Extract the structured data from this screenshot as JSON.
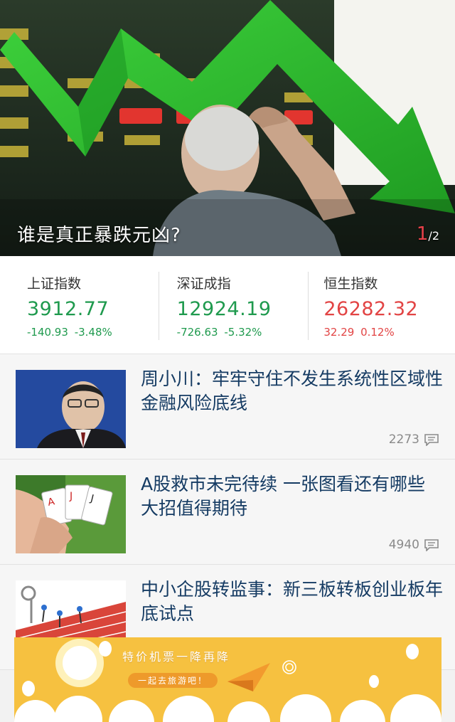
{
  "hero": {
    "caption": "谁是真正暴跌元凶?",
    "page_current": "1",
    "page_total": "2",
    "page_separator": "/"
  },
  "indices": [
    {
      "name": "上证指数",
      "value": "3912.77",
      "change": "-140.93",
      "percent": "-3.48%",
      "trend": "down"
    },
    {
      "name": "深证成指",
      "value": "12924.19",
      "change": "-726.63",
      "percent": "-5.32%",
      "trend": "down"
    },
    {
      "name": "恒生指数",
      "value": "26282.32",
      "change": "32.29",
      "percent": "0.12%",
      "trend": "up"
    }
  ],
  "news": [
    {
      "title": "周小川：牢牢守住不发生系统性区域性金融风险底线",
      "comments": "2273",
      "thumb": "official-portrait"
    },
    {
      "title": "A股救市未完待续 一张图看还有哪些大招值得期待",
      "comments": "4940",
      "thumb": "playing-cards"
    },
    {
      "title": "中小企股转监事：新三板转板创业板年底试点",
      "comments": "",
      "thumb": "hurdle-race"
    }
  ],
  "ad": {
    "title": "特价机票一降再降",
    "subtitle": "一起去旅游吧！"
  },
  "colors": {
    "down": "#1f9a4e",
    "up": "#e24444",
    "headline": "#153b63"
  }
}
